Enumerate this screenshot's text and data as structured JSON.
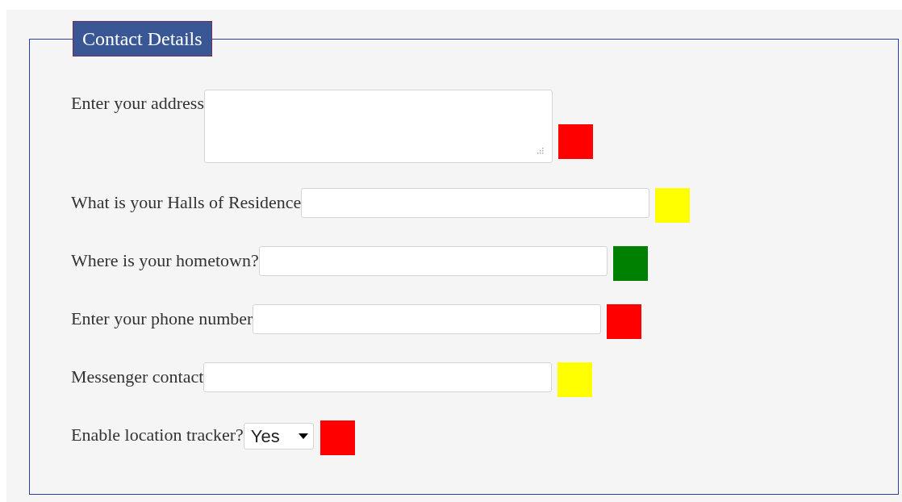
{
  "legend": "Contact Details",
  "fields": [
    {
      "kind": "textarea",
      "label": "Enter your address",
      "color": "#ff0000"
    },
    {
      "kind": "text",
      "label": "What is your Halls of Residence",
      "color": "#ffff00"
    },
    {
      "kind": "text",
      "label": "Where is your hometown?",
      "color": "#008000"
    },
    {
      "kind": "text",
      "label": "Enter your phone number",
      "color": "#ff0000"
    },
    {
      "kind": "text",
      "label": "Messenger contact",
      "color": "#ffff00"
    },
    {
      "kind": "select",
      "label": "Enable location tracker?",
      "value": "Yes",
      "color": "#ff0000"
    }
  ]
}
